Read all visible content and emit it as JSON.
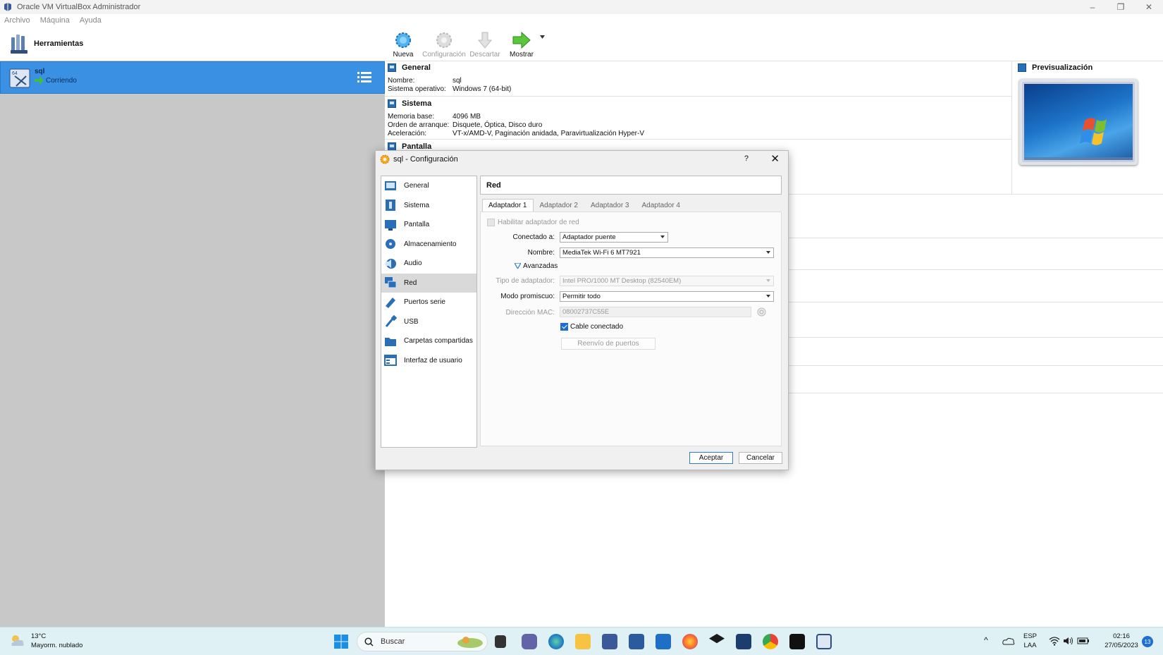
{
  "window": {
    "title": "Oracle VM VirtualBox Administrador"
  },
  "menu": [
    "Archivo",
    "Máquina",
    "Ayuda"
  ],
  "tools": {
    "label": "Herramientas"
  },
  "vm": {
    "name": "sql",
    "state": "Corriendo"
  },
  "toolbar": {
    "nueva": "Nueva",
    "configuracion": "Configuración",
    "descartar": "Descartar",
    "mostrar": "Mostrar"
  },
  "details": {
    "general": {
      "title": "General",
      "nombre_k": "Nombre:",
      "nombre_v": "sql",
      "so_k": "Sistema operativo:",
      "so_v": "Windows 7 (64-bit)"
    },
    "sistema": {
      "title": "Sistema",
      "mem_k": "Memoria base:",
      "mem_v": "4096 MB",
      "boot_k": "Orden de arranque:",
      "boot_v": "Disquete, Óptica, Disco duro",
      "acc_k": "Aceleración:",
      "acc_v": "VT-x/AMD-V, Paginación anidada, Paravirtualización Hyper-V"
    },
    "pantalla": {
      "title": "Pantalla"
    }
  },
  "preview": {
    "title": "Previsualización"
  },
  "dialog": {
    "title": "sql - Configuración",
    "help": "?",
    "nav": [
      "General",
      "Sistema",
      "Pantalla",
      "Almacenamiento",
      "Audio",
      "Red",
      "Puertos serie",
      "USB",
      "Carpetas compartidas",
      "Interfaz de usuario"
    ],
    "page_title": "Red",
    "tabs": [
      "Adaptador 1",
      "Adaptador 2",
      "Adaptador 3",
      "Adaptador 4"
    ],
    "enable_label": "Habilitar adaptador de red",
    "attached_label": "Conectado a:",
    "attached_value": "Adaptador puente",
    "name_label": "Nombre:",
    "name_value": "MediaTek Wi-Fi 6 MT7921",
    "advanced_label": "Avanzadas",
    "adapter_type_label": "Tipo de adaptador:",
    "adapter_type_value": "Intel PRO/1000 MT Desktop (82540EM)",
    "promisc_label": "Modo promiscuo:",
    "promisc_value": "Permitir todo",
    "mac_label": "Dirección MAC:",
    "mac_value": "08002737C55E",
    "cable_label": "Cable conectado",
    "port_forward": "Reenvío de puertos",
    "ok": "Aceptar",
    "cancel": "Cancelar"
  },
  "taskbar": {
    "temp": "13°C",
    "weather": "Mayorm. nublado",
    "search": "Buscar",
    "lang1": "ESP",
    "lang2": "LAA",
    "time": "02:16",
    "date": "27/05/2023",
    "badge": "13"
  },
  "colors": {
    "selection": "#3a91e4",
    "accent": "#1f6fd1",
    "taskbar": "#dff1f4"
  }
}
